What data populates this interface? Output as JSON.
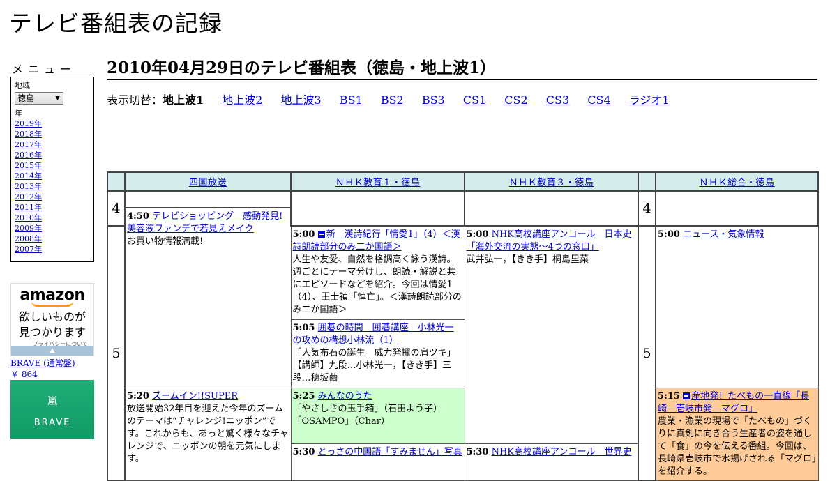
{
  "site": {
    "title": "テレビ番組表の記録"
  },
  "menu": {
    "title": "メニュー",
    "region_label": "地域",
    "region_value": "徳島",
    "year_label": "年",
    "years": [
      "2019年",
      "2018年",
      "2017年",
      "2016年",
      "2015年",
      "2014年",
      "2013年",
      "2012年",
      "2011年",
      "2010年",
      "2009年",
      "2008年",
      "2007年"
    ]
  },
  "ad": {
    "logo": "amazon",
    "text_line1": "欲しいものが",
    "text_line2": "見つかります",
    "privacy": "プライバシーについて",
    "product_name": "BRAVE (通常盤)",
    "product_price": "￥ 864",
    "product_img_line1": "嵐",
    "product_img_line2": "BRAVE"
  },
  "page": {
    "heading": "2010年04月29日のテレビ番組表（徳島・地上波1）",
    "switch_label": "表示切替：",
    "current": "地上波1",
    "links": [
      "地上波2",
      "地上波3",
      "BS1",
      "BS2",
      "BS3",
      "CS1",
      "CS2",
      "CS3",
      "CS4",
      "ラジオ1"
    ]
  },
  "schedule": {
    "channels": [
      "四国放送",
      "ＮＨＫ教育１・徳島",
      "ＮＨＫ教育３・徳島",
      "ＮＨＫ総合・徳島"
    ],
    "hour4": "4",
    "hour5": "5",
    "programs": {
      "ch1_a": {
        "time": "4:50",
        "title": "テレビショッピング　感動発見!美容液ファンデで若見えメイク",
        "desc": "お買い物情報満載!"
      },
      "ch1_b": {
        "time": "5:20",
        "title": "ズームイン!!SUPER",
        "desc": "放送開始32年目を迎えた今年のズームのテーマは“チャレンジ!ニッポン”です。これからも、あっと驚く様々なチャレンジで、ニッポンの朝を元気にします。"
      },
      "ch2_a": {
        "time": "5:00",
        "title": "新　漢詩紀行「情愛1」（4）＜漢詩朗読部分のみ二か国語＞",
        "desc": "人生や友愛、自然を格調高く詠う漢詩。週ごとにテーマ分けし、朗読・解説と共にエピソードなどを紹介。今回は情愛1（4）、王士禎「悼亡」。＜漢詩朗読部分のみ二か国語＞"
      },
      "ch2_b": {
        "time": "5:05",
        "title": "囲碁の時間　囲碁講座　小林光一の攻めの構想小林流（1）",
        "desc": "「人気布石の誕生　威力発揮の肩ツキ」【講師】九段…小林光一，【きき手】三段…穂坂繭"
      },
      "ch2_c": {
        "time": "5:25",
        "title": "みんなのうた",
        "desc": "「やさしさの玉手箱」（石田よう子）「OSAMPO」（Char）"
      },
      "ch2_d": {
        "time": "5:30",
        "title": "とっさの中国語「すみません」写真",
        "desc": ""
      },
      "ch3_a": {
        "time": "5:00",
        "title": "NHK高校講座アンコール　日本史「海外交流の実態～4つの窓口」",
        "desc": "武井弘一，【きき手】桐島里菜"
      },
      "ch3_b": {
        "time": "5:30",
        "title": "NHK高校講座アンコール　世界史",
        "desc": ""
      },
      "ch4_a": {
        "time": "5:00",
        "title": "ニュース・気象情報",
        "desc": ""
      },
      "ch4_b": {
        "time": "5:15",
        "title": "産地発！たべもの一直線「長崎　壱岐市発　マグロ」",
        "desc": "農業・漁業の現場で「たべもの」づくりに真剣に向き合う生産者の姿を通して「食」の今を伝える番組。今回は、長崎県壱岐市で水揚げされる「マグロ」を紹介する。"
      }
    }
  }
}
